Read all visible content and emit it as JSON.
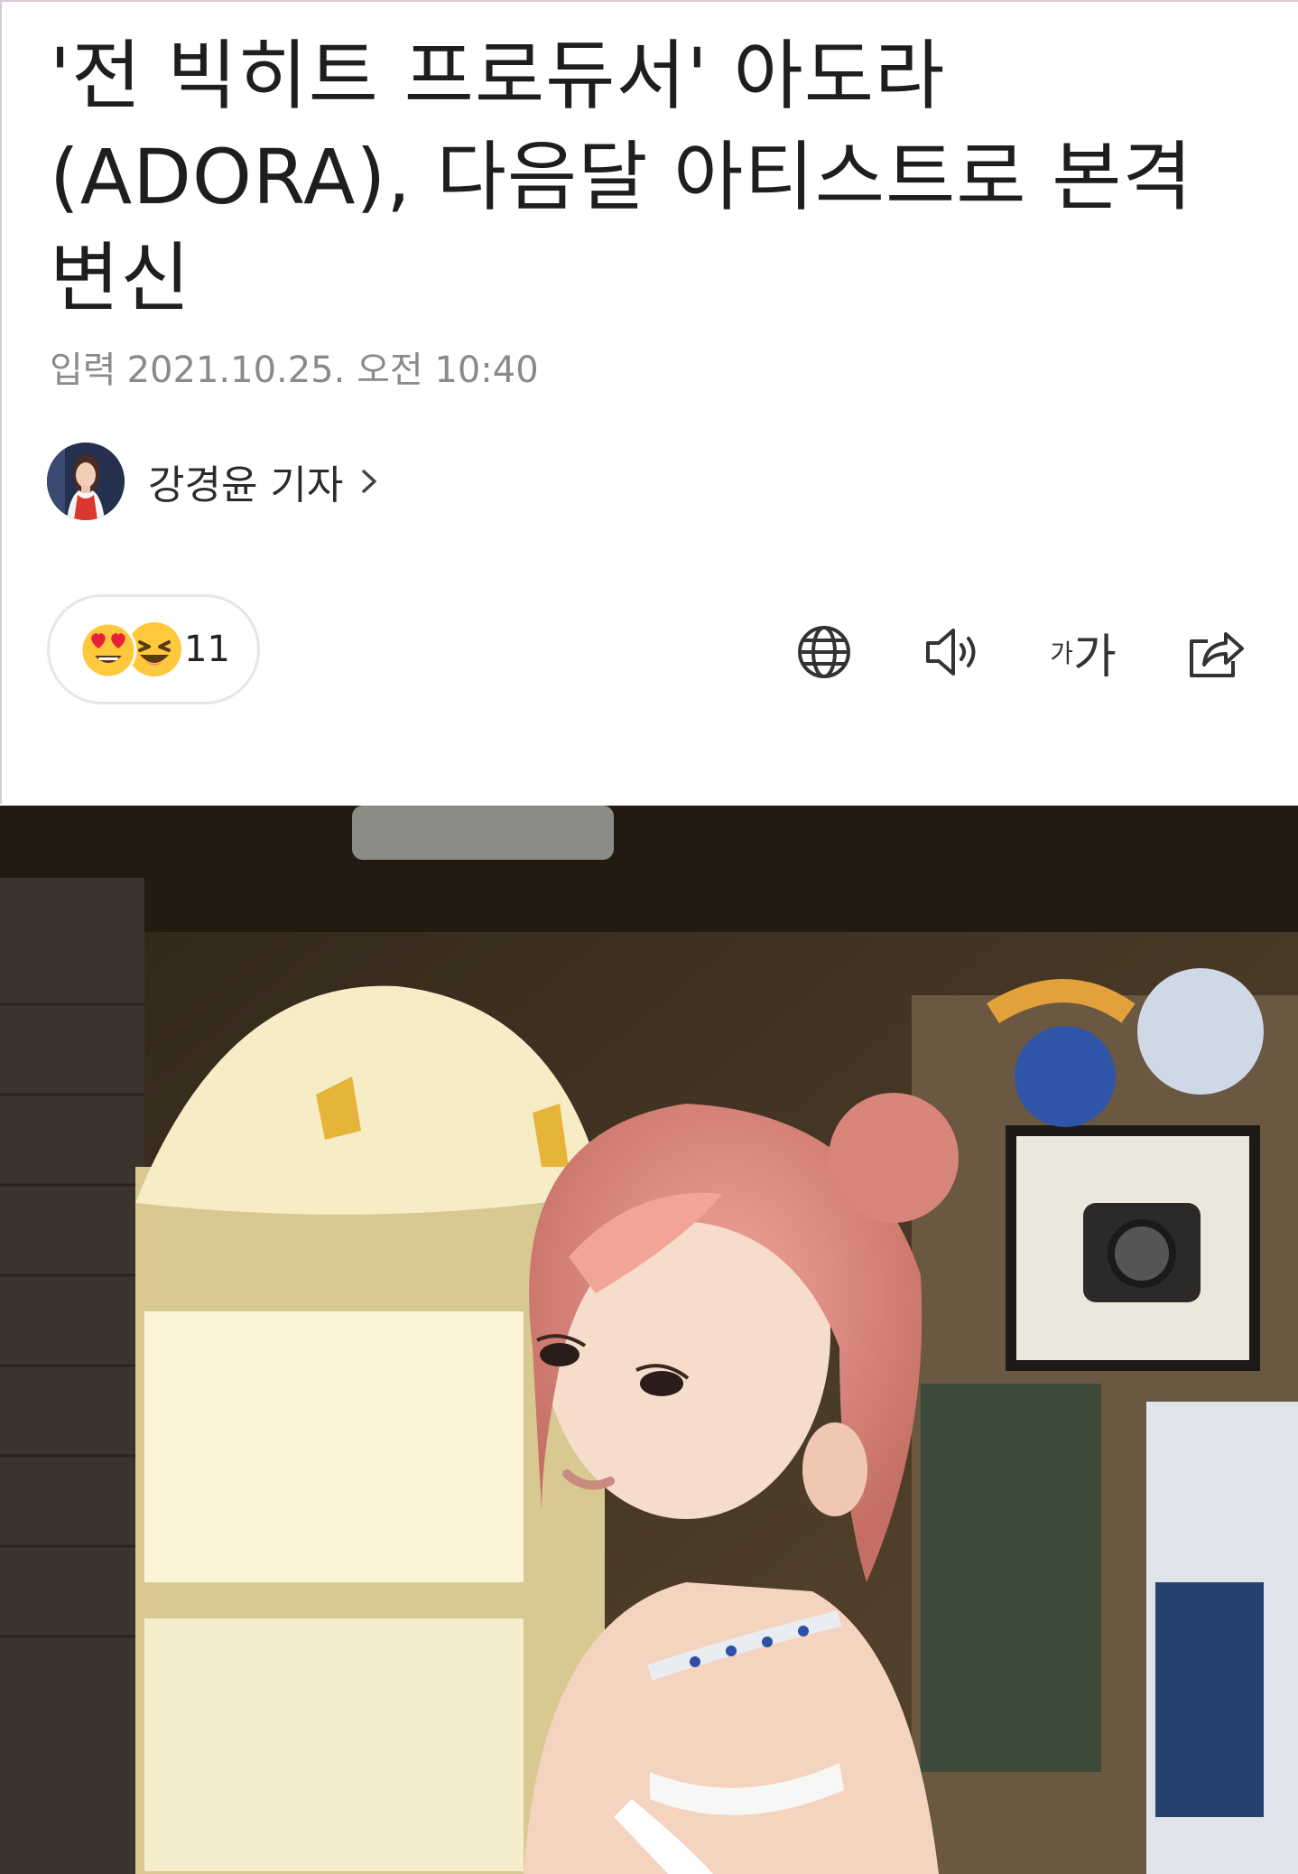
{
  "article": {
    "headline": "'전 빅히트 프로듀서' 아도라(ADORA), 다음달 아티스트로 본격 변신",
    "published_label": "입력",
    "published_datetime": "2021.10.25. 오전 10:40",
    "reporter_name": "강경윤 기자"
  },
  "reactions": {
    "count": "11",
    "emojis": [
      "heart-eyes-emoji-icon",
      "laughing-emoji-icon"
    ]
  },
  "toolbar": {
    "icons": [
      "globe-icon",
      "speaker-icon",
      "font-size-icon",
      "share-icon"
    ],
    "font_size_small": "가",
    "font_size_large": "가"
  },
  "colors": {
    "emoji_yellow": "#ffc83d",
    "heart_red": "#e8203a",
    "meta_gray": "#8a8a8a",
    "border_gray": "#e6e6e6"
  }
}
